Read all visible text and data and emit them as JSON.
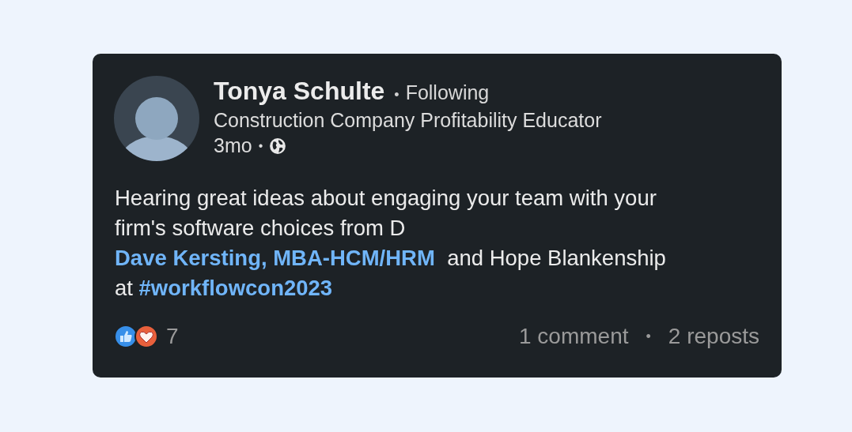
{
  "post": {
    "author": "Tonya Schulte",
    "separator": "•",
    "follow_status": "Following",
    "headline": "Construction Company Profitability Educator",
    "age": "3mo",
    "age_separator": "•",
    "body": [
      [
        {
          "kind": "text",
          "text": "Hearing great ideas about engaging your team with your"
        }
      ],
      [
        {
          "kind": "text",
          "text": "firm's software choices from D"
        }
      ],
      [
        {
          "kind": "mention",
          "text": "Dave Kersting, MBA-HCM/HRM"
        },
        {
          "kind": "text",
          "text": "  and Hope Blankenship"
        }
      ],
      [
        {
          "kind": "text",
          "text": "at "
        },
        {
          "kind": "hashtag",
          "text": "#workflowcon2023"
        }
      ]
    ],
    "reaction_count": "7",
    "comments": "1 comment",
    "stats_separator": "•",
    "reposts": "2 reposts"
  }
}
